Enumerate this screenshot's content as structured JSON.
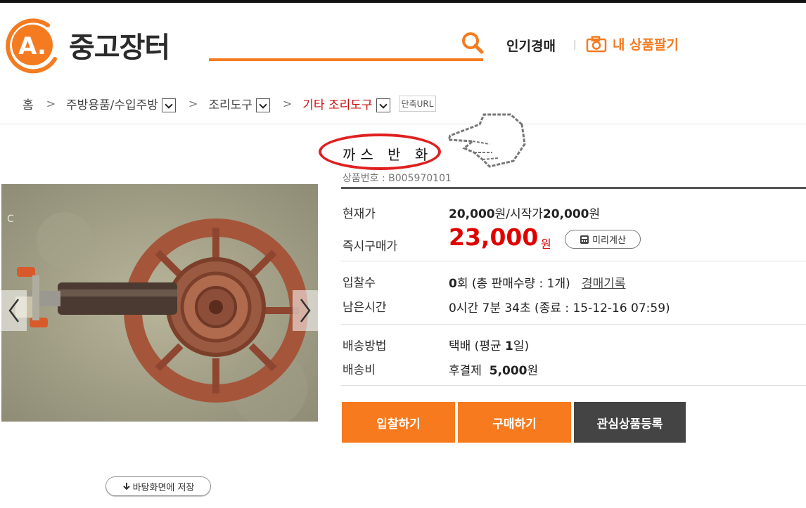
{
  "header": {
    "logo_letter": "A.",
    "logo_text": "중고장터",
    "popular": "인기경매",
    "separator": "|",
    "sell": "내 상품팔기"
  },
  "breadcrumb": {
    "home": "홈",
    "items": [
      "주방용품/수입주방",
      "조리도구",
      "기타 조리도구"
    ],
    "short_url": "단축URL"
  },
  "product": {
    "title": "까스 반 화",
    "item_no": "상품번호 : B005970101"
  },
  "info": {
    "current_price_label": "현재가",
    "current_price_value": "20,000",
    "current_price_unit": "원",
    "start_price_label": "/시작가",
    "start_price_value": "20,000",
    "start_price_unit": "원",
    "buy_now_label": "즉시구매가",
    "buy_now_price": "23,000",
    "buy_now_unit": "원",
    "calc_button": "미리계산",
    "bids_label": "입찰수",
    "bids_count": "0",
    "bids_rest": "회 (총 판매수량 : 1개)",
    "auction_record": "경매기록",
    "remaining_label": "남은시간",
    "remaining_value": "0시간 7분 34초 (종료 : 15-12-16 07:59)",
    "shipping_method_label": "배송방법",
    "shipping_method_pre": "택배 (평균 ",
    "shipping_method_days": "1",
    "shipping_method_post": "일)",
    "shipping_cost_label": "배송비",
    "shipping_cost_pre": "후결제",
    "shipping_cost_value": "5,000",
    "shipping_cost_unit": "원"
  },
  "buttons": {
    "bid": "입찰하기",
    "buy": "구매하기",
    "watch": "관심상품등록",
    "save": "바탕화면에 저장"
  },
  "colors": {
    "accent": "#f47b20",
    "price": "#e00000",
    "annotation": "#e02020"
  }
}
